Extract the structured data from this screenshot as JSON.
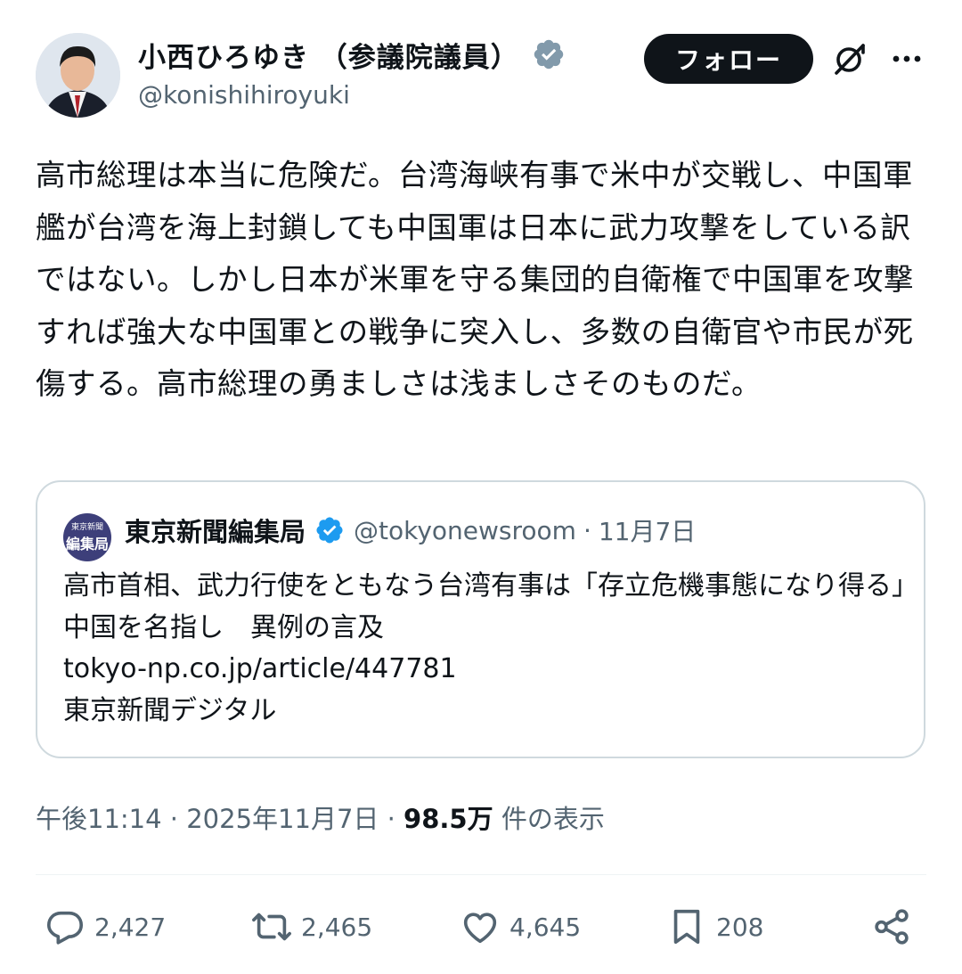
{
  "author": {
    "name": "小西ひろゆき （参議院議員）",
    "handle": "@konishihiroyuki",
    "verified_color": "#829aab"
  },
  "actions_top": {
    "follow_label": "フォロー",
    "grok_icon": "grok-icon",
    "more_icon": "more-icon"
  },
  "tweet": {
    "text": "高市総理は本当に危険だ。台湾海峡有事で米中が交戦し、中国軍艦が台湾を海上封鎖しても中国軍は日本に武力攻撃をしている訳ではない。しかし日本が米軍を守る集団的自衛権で中国軍を攻撃すれば強大な中国軍との戦争に突入し、多数の自衛官や市民が死傷する。高市総理の勇ましさは浅ましさそのものだ。"
  },
  "quote": {
    "avatar_text_top": "東京新聞",
    "avatar_text_main": "編集局",
    "name": "東京新聞編集局",
    "handle": "@tokyonewsroom",
    "separator": "·",
    "date": "11月7日",
    "verified_color": "#1d9bf0",
    "text": "高市首相、武力行使をともなう台湾有事は「存立危機事態になり得る」　中国を名指し　異例の言及\ntokyo-np.co.jp/article/447781\n東京新聞デジタル"
  },
  "meta": {
    "time": "午後11:14",
    "sep1": " · ",
    "date": "2025年11月7日",
    "sep2": " · ",
    "views": "98.5万",
    "views_label": " 件の表示"
  },
  "actions": {
    "replies": "2,427",
    "reposts": "2,465",
    "likes": "4,645",
    "bookmarks": "208",
    "icon_color": "#536471"
  }
}
